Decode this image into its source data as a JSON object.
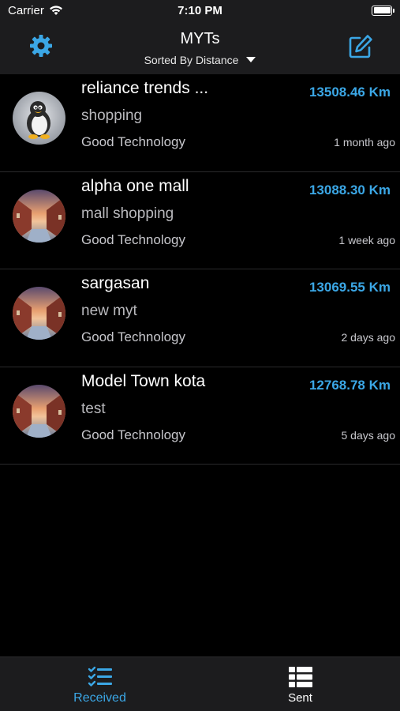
{
  "status_bar": {
    "carrier": "Carrier",
    "time": "7:10 PM"
  },
  "nav": {
    "title": "MYTs",
    "sort_label": "Sorted By Distance",
    "left_icon": "gear-icon",
    "right_icon": "compose-icon",
    "accent_color": "#3ba7e6"
  },
  "items": [
    {
      "title": "reliance trends ...",
      "subtitle": "shopping",
      "company": "Good Technology",
      "distance": "13508.46 Km",
      "time": "1 month ago",
      "avatar": "penguin-avatar"
    },
    {
      "title": "alpha one mall",
      "subtitle": "mall shopping",
      "company": "Good Technology",
      "distance": "13088.30 Km",
      "time": "1 week ago",
      "avatar": "canal-sunset-photo"
    },
    {
      "title": "sargasan",
      "subtitle": "new myt",
      "company": "Good Technology",
      "distance": "13069.55 Km",
      "time": "2 days ago",
      "avatar": "canal-sunset-photo"
    },
    {
      "title": "Model Town kota",
      "subtitle": "test",
      "company": "Good Technology",
      "distance": "12768.78 Km",
      "time": "5 days ago",
      "avatar": "canal-sunset-photo"
    }
  ],
  "tabs": [
    {
      "label": "Received",
      "icon": "checklist-icon",
      "selected": true
    },
    {
      "label": "Sent",
      "icon": "grid-list-icon",
      "selected": false
    }
  ]
}
